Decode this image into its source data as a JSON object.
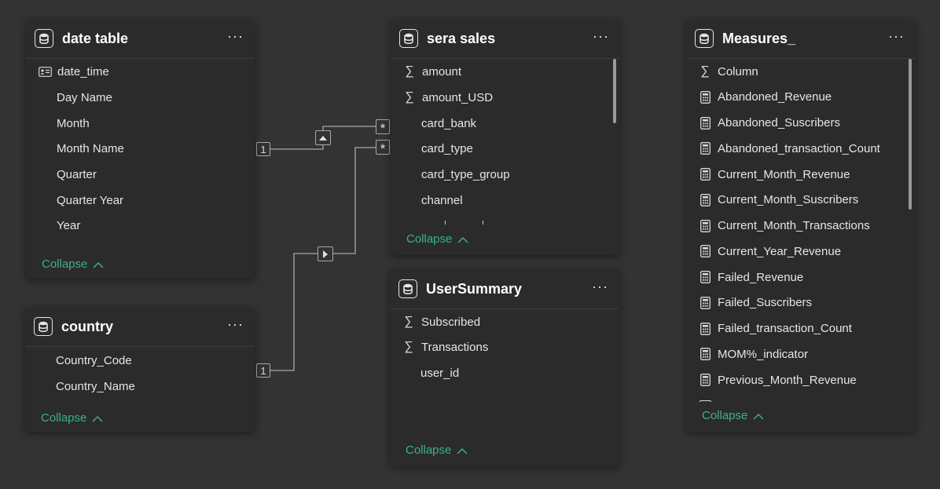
{
  "tables": {
    "date_table": {
      "title": "date table",
      "fields": [
        "date_time",
        "Day Name",
        "Month",
        "Month Name",
        "Quarter",
        "Quarter Year",
        "Year"
      ],
      "collapse_label": "Collapse"
    },
    "country": {
      "title": "country",
      "fields": [
        "Country_Code",
        "Country_Name"
      ],
      "collapse_label": "Collapse"
    },
    "sera_sales": {
      "title": "sera sales",
      "fields": [
        "amount",
        "amount_USD",
        "card_bank",
        "card_type",
        "card_type_group",
        "channel"
      ],
      "collapse_label": "Collapse"
    },
    "user_summary": {
      "title": "UserSummary",
      "fields": [
        "Subscribed",
        "Transactions",
        "user_id"
      ],
      "collapse_label": "Collapse"
    },
    "measures": {
      "title": "Measures_",
      "fields": [
        "Column",
        "Abandoned_Revenue",
        "Abandoned_Suscribers",
        "Abandoned_transaction_Count",
        "Current_Month_Revenue",
        "Current_Month_Suscribers",
        "Current_Month_Transactions",
        "Current_Year_Revenue",
        "Failed_Revenue",
        "Failed_Suscribers",
        "Failed_transaction_Count",
        "MOM%_indicator",
        "Previous_Month_Revenue"
      ],
      "collapse_label": "Collapse"
    }
  },
  "relationships": {
    "date_to_sales": {
      "from_cardinality": "1",
      "to_cardinality": "*"
    },
    "country_to_sales": {
      "from_cardinality": "1",
      "to_cardinality": "*"
    }
  },
  "icons": {
    "table": "database-icon",
    "key": "id-card-icon",
    "sum": "sigma-icon",
    "measure": "calculator-icon",
    "more": "ellipsis-icon",
    "collapse": "chevron-up-icon"
  },
  "colors": {
    "background": "#333333",
    "card": "#2b2b2b",
    "accent": "#3cb08e",
    "line": "#9a9a9a"
  }
}
